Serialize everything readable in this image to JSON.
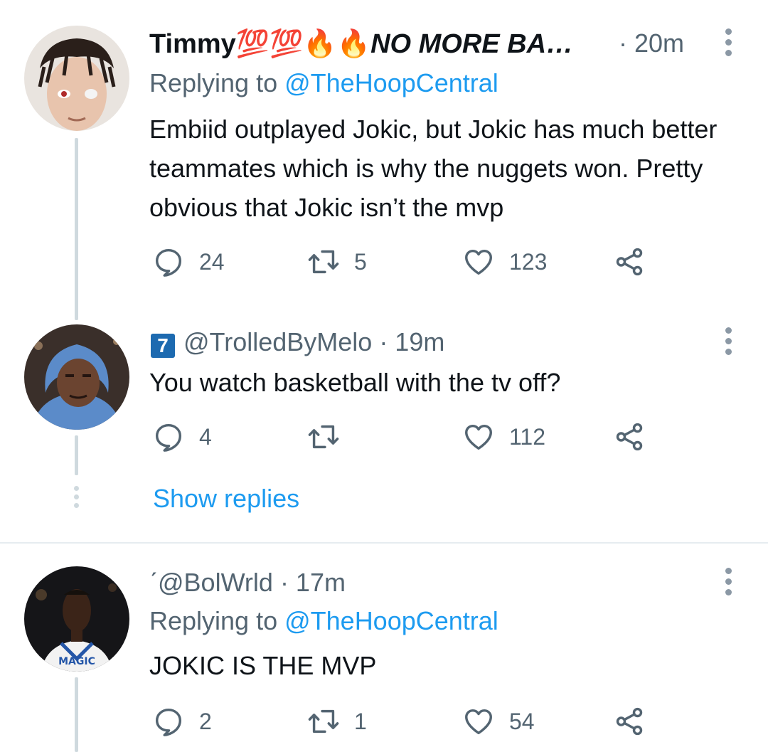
{
  "tweets": [
    {
      "display_name": "Timmy💯💯🔥🔥",
      "display_name_suffix": "NO MORE BA…",
      "timestamp": "· 20m",
      "replying_prefix": "Replying to ",
      "replying_handle": "@TheHoopCentral",
      "text": "Embiid outplayed Jokic, but Jokic has much better teammates which is why the nuggets won. Pretty obvious that Jokic isn’t the mvp",
      "replies": "24",
      "retweets": "5",
      "likes": "123"
    },
    {
      "badge": "7",
      "handle": "@TrolledByMelo",
      "timestamp": "· 19m",
      "text": "You watch basketball with the tv off?",
      "replies": "4",
      "retweets": "",
      "likes": "112"
    },
    {
      "prefix_mark": "ˊ",
      "handle": "@BolWrld",
      "timestamp": "· 17m",
      "replying_prefix": "Replying to ",
      "replying_handle": "@TheHoopCentral",
      "text": "JOKIC IS THE MVP",
      "replies": "2",
      "retweets": "1",
      "likes": "54"
    }
  ],
  "show_replies_label": "Show replies",
  "icons": {
    "reply": "reply-icon",
    "retweet": "retweet-icon",
    "like": "like-icon",
    "share": "share-icon",
    "more": "more-icon"
  },
  "colors": {
    "link": "#1d9bf0",
    "secondary_text": "#536471",
    "thread_line": "#cfd9de"
  }
}
